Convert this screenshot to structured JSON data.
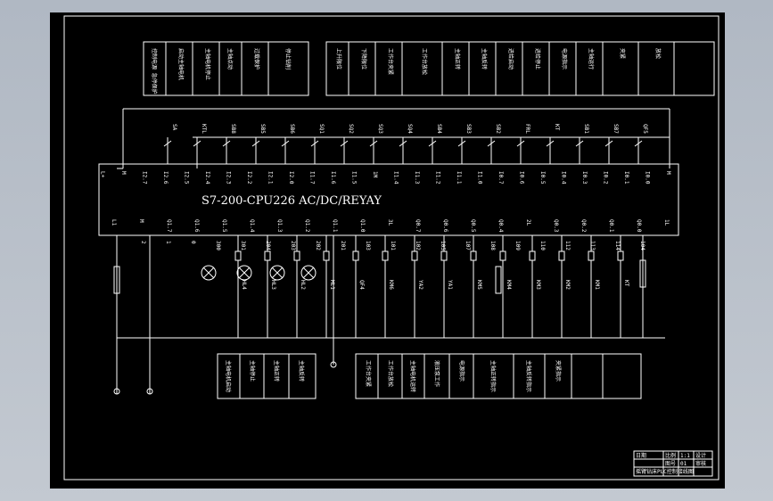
{
  "plc_model": "S7-200-CPU226 AC/DC/REYAY",
  "top_terminals": [
    "M",
    "I0.0",
    "I0.1",
    "I0.2",
    "I0.3",
    "I0.4",
    "I0.5",
    "I0.6",
    "I0.7",
    "I1.0",
    "I1.1",
    "I1.2",
    "I1.3",
    "I1.4",
    "1M",
    "I1.5",
    "I1.6",
    "I1.7",
    "I2.0",
    "I2.1",
    "I2.2",
    "I2.3",
    "I2.4",
    "I2.5",
    "I2.6",
    "I2.7",
    "M",
    "L+"
  ],
  "top_devices": [
    "QF5",
    "SB7",
    "SB1",
    "KT",
    "FRL",
    "SB2",
    "SB3",
    "SB4",
    "SQ4",
    "SQ3",
    "SQ2",
    "SQ1",
    "SB6",
    "SB5",
    "SB8",
    "KTL",
    "SA"
  ],
  "bottom_terminals": [
    "1L",
    "Q0.0",
    "Q0.1",
    "Q0.2",
    "Q0.3",
    "2L",
    "Q0.4",
    "Q0.5",
    "Q0.6",
    "Q0.7",
    "3L",
    "Q1.0",
    "Q1.1",
    "Q1.2",
    "Q1.3",
    "Q1.4",
    "Q1.5",
    "Q1.6",
    "Q1.7",
    "M",
    "L1"
  ],
  "wire_numbers": [
    "104",
    "114",
    "113",
    "112",
    "110",
    "109",
    "108",
    "107",
    "105",
    "102",
    "101",
    "103",
    "201",
    "202",
    "203",
    "204",
    "301",
    "300",
    "0",
    "1",
    "2"
  ],
  "output_devices": [
    "KT",
    "KM1",
    "KM2",
    "KM3",
    "KM4",
    "KM5",
    "YA1",
    "YA2",
    "KM6",
    "QF4",
    "HL1",
    "HL2",
    "HL3",
    "HL4"
  ],
  "fuses": [
    "FU1",
    "FU2",
    "FU3"
  ],
  "top_labels": [
    "控制电源 急停保护",
    "启动主轴电机",
    "主轴电机停止",
    "主轴点动",
    "过载保护",
    "停止钻削",
    "上升限位",
    "下降限位",
    "工作台夹紧",
    "工作台放松",
    "主轴正转",
    "主轴反转",
    "进给启动",
    "进给停止",
    "电源指示",
    "主轴运行",
    "夹紧",
    "放松"
  ],
  "bottom_labels": [
    "主轴电机启动",
    "主轴停止",
    "主轴正转",
    "主轴反转",
    "工作台夹紧",
    "工作台放松",
    "主轴电机运转",
    "液压泵工作",
    "电源指示",
    "主轴正转指示",
    "主轴反转指示",
    "夹紧指示"
  ],
  "title_block": [
    "摇臂钻床PLC控制接线图",
    "比例",
    "1:1",
    "图号",
    "01",
    "设计",
    "审核",
    "日期"
  ]
}
